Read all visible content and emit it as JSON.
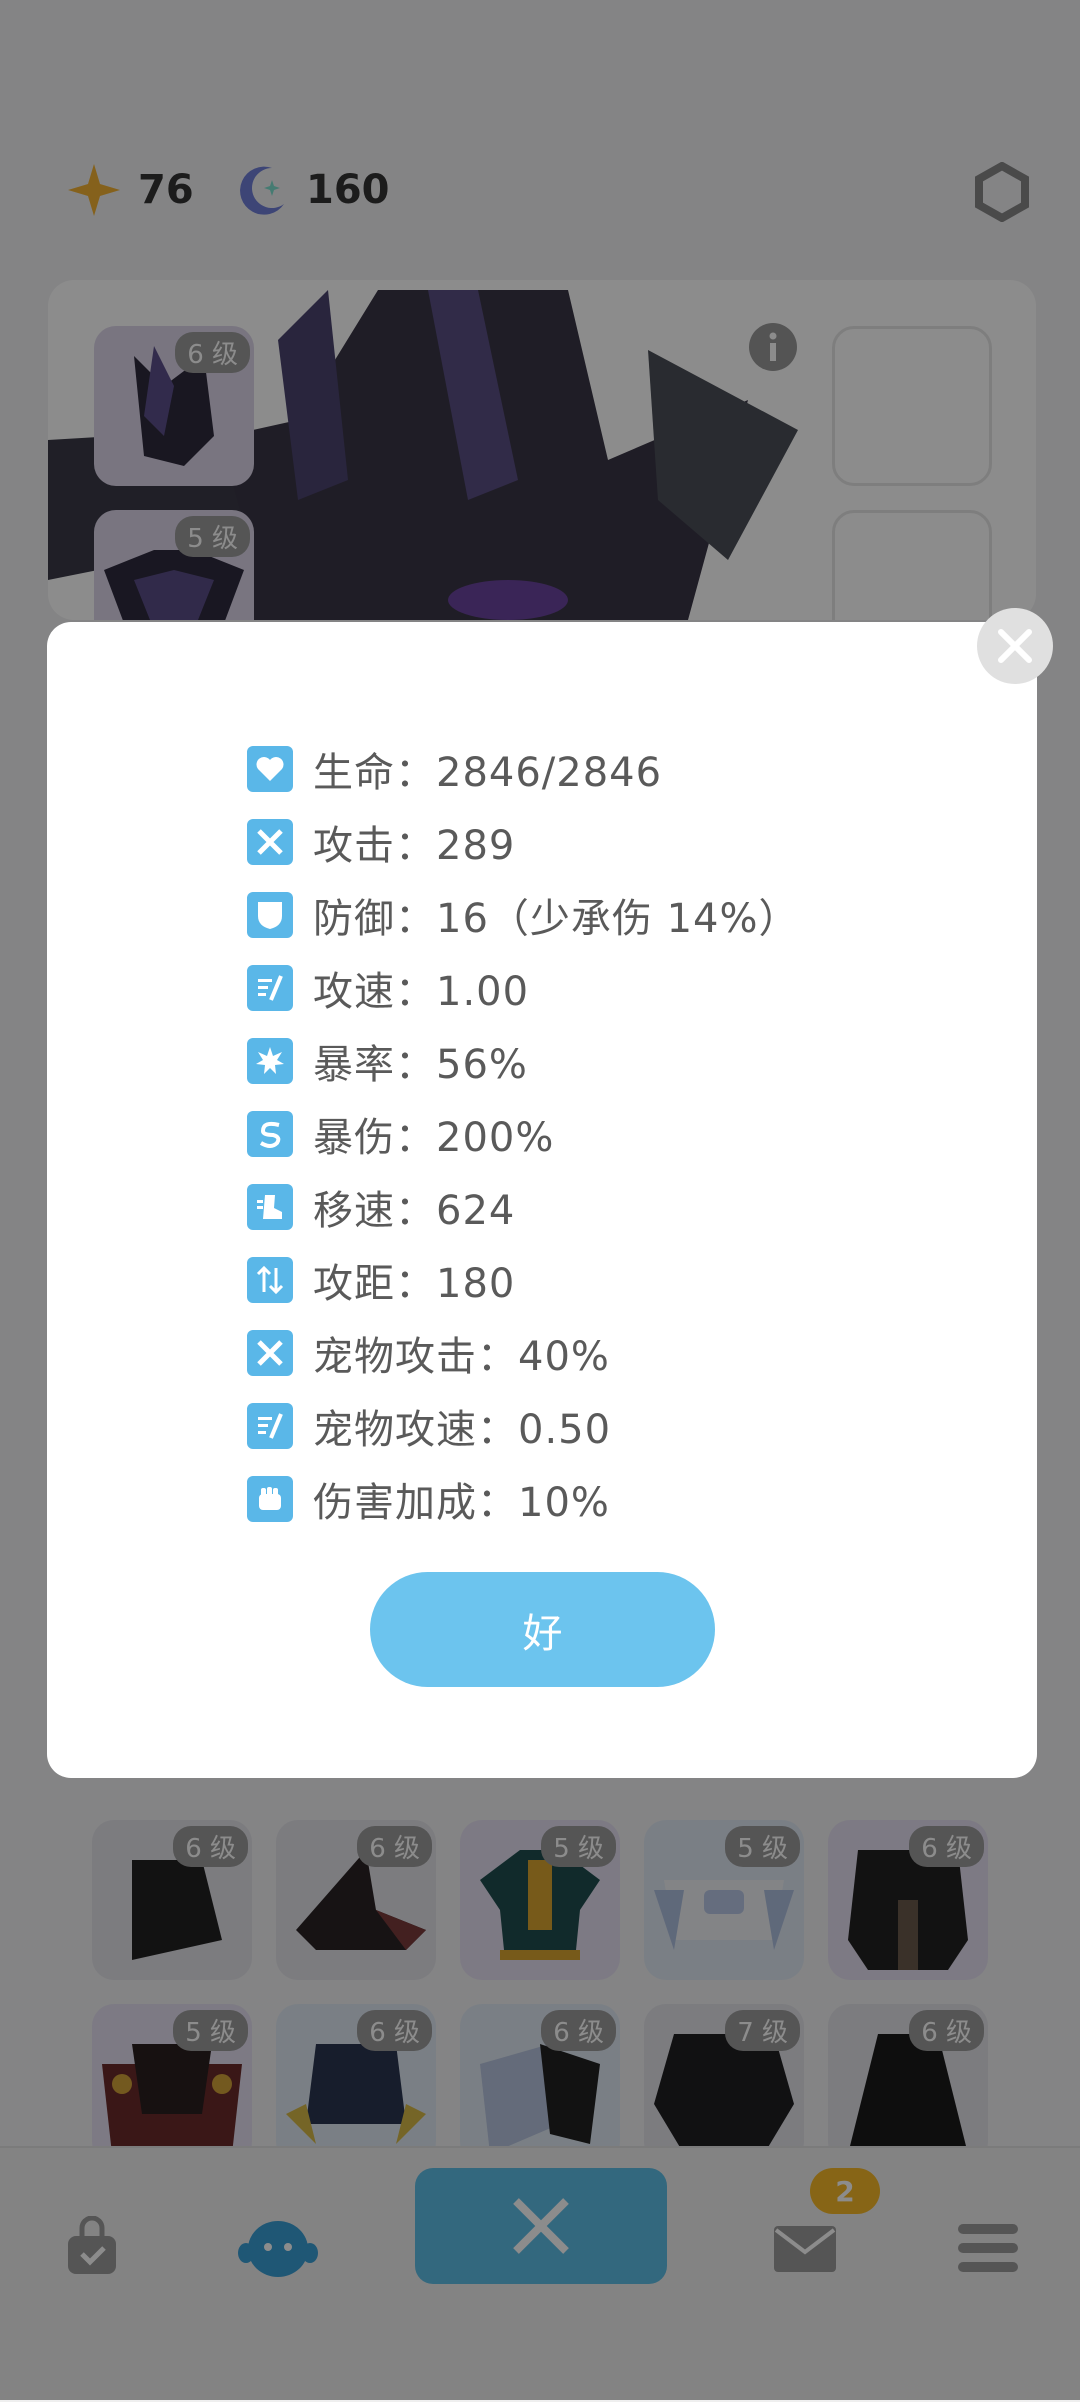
{
  "topbar": {
    "star_count": "76",
    "moon_count": "160"
  },
  "equipment": {
    "slot1_level": "6 级",
    "slot2_level": "5 级"
  },
  "grid": {
    "row1": [
      "6 级",
      "6 级",
      "5 级",
      "5 级",
      "6 级"
    ],
    "row2": [
      "5 级",
      "6 级",
      "6 级",
      "7 级",
      "6 级"
    ]
  },
  "nav": {
    "mail_badge": "2"
  },
  "modal": {
    "stats": [
      {
        "icon": "heart-icon",
        "text": "生命：2846/2846"
      },
      {
        "icon": "crossed-swords-icon",
        "text": "攻击：289"
      },
      {
        "icon": "shield-icon",
        "text": "防御：16（少承伤 14%）"
      },
      {
        "icon": "attack-speed-icon",
        "text": "攻速：1.00"
      },
      {
        "icon": "crit-burst-icon",
        "text": "暴率：56%"
      },
      {
        "icon": "crit-damage-icon",
        "text": "暴伤：200%"
      },
      {
        "icon": "boot-icon",
        "text": "移速：624"
      },
      {
        "icon": "range-arrows-icon",
        "text": "攻距：180"
      },
      {
        "icon": "crossed-swords-icon",
        "text": "宠物攻击：40%"
      },
      {
        "icon": "attack-speed-icon",
        "text": "宠物攻速：0.50"
      },
      {
        "icon": "fist-icon",
        "text": "伤害加成：10%"
      }
    ],
    "ok_label": "好"
  },
  "colors": {
    "accent": "#6cc4ee",
    "icon_bg": "#5ab7e8",
    "badge": "#f6b928"
  }
}
